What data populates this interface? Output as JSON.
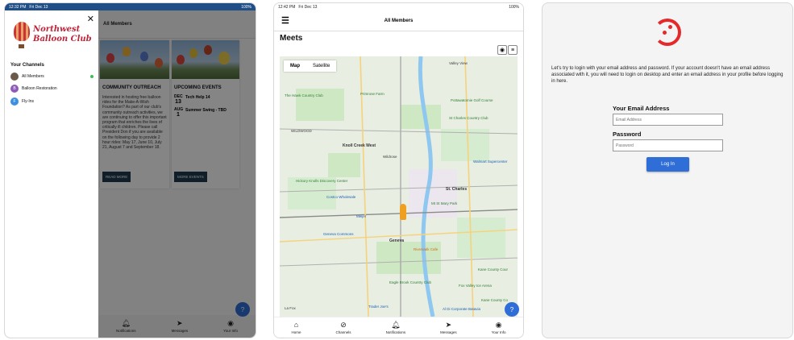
{
  "screen1": {
    "status": {
      "time": "12:32 PM",
      "date": "Fri Dec 13",
      "battery": "100%"
    },
    "header_title": "All Members",
    "logo_text": "Northwest Balloon Club",
    "channels_title": "Your Channels",
    "channels": [
      {
        "label": "All Members",
        "avatar": ""
      },
      {
        "label": "Balloon Restoration",
        "avatar": "B"
      },
      {
        "label": "Fly-Ins",
        "avatar": "F"
      }
    ],
    "card1": {
      "title": "COMMUNITY OUTREACH",
      "body": "Interested in hosting free balloon rides for the Make-A-Wish Foundation? As part of our club's community outreach activities, we are continuing to offer this important program that enriches the lives of critically ill children. Please call President Don if you are available on the following day to provide 2 hour rides: May 17, June 10, July 21, August 7 and September 18.",
      "button": "READ MORE"
    },
    "card2": {
      "title": "UPCOMING EVENTS",
      "events": [
        {
          "month": "DEC",
          "day": "13",
          "title": "Tech Help 14"
        },
        {
          "month": "AUG",
          "day": "1",
          "title": "Summer Swing - TBD"
        }
      ],
      "button": "MORE EVENTS"
    },
    "tabs": [
      {
        "label": "Notifications",
        "icon": "bell-icon"
      },
      {
        "label": "Messages",
        "icon": "send-icon"
      },
      {
        "label": "Your Info",
        "icon": "person-icon"
      }
    ]
  },
  "screen2": {
    "status": {
      "time": "12:42 PM",
      "date": "Fri Dec 13",
      "battery": "100%"
    },
    "header_title": "All Members",
    "section_title": "Meets",
    "map_tabs": {
      "map": "Map",
      "satellite": "Satellite"
    },
    "places": {
      "valley_view": "Valley View",
      "hawk_country_club": "The Hawk Country Club",
      "primrose_farm": "Primrose Farm",
      "pottawatomie": "Pottawatomie Golf Course",
      "st_charles_cc": "St Charles Country Club",
      "wildwood": "WILDWOOD",
      "knoll_creek_west": "Knoll Creek West",
      "wildrose": "Wildrose",
      "walmart": "Walmart Supercenter",
      "hickory_knolls": "Hickory Knolls Discovery Center",
      "costco": "Costco Wholesale",
      "st_charles": "St. Charles",
      "mt_st_mary": "Mt St Mary Park",
      "meijer": "Meijer",
      "geneva_commons": "Geneva Commons",
      "geneva": "Geneva",
      "riverwalk": "Riverwalk Cafe",
      "kane_county": "Kane County Cour",
      "eagle_brook": "Eagle Brook Country Club",
      "fox_valley": "Fox Valley Ice Arena",
      "trader_joes": "Trader Joe's",
      "al_di": "Al Di Corporate Batavia",
      "kane_county2": "Kane County Co",
      "la_fox": "La Fox"
    },
    "tabs": [
      {
        "label": "Home",
        "icon": "home-icon"
      },
      {
        "label": "Channels",
        "icon": "compass-icon"
      },
      {
        "label": "Notifications",
        "icon": "bell-icon"
      },
      {
        "label": "Messages",
        "icon": "send-icon"
      },
      {
        "label": "Your Info",
        "icon": "person-icon"
      }
    ]
  },
  "screen3": {
    "intro": "Let's try to login with your email address and password. If your account doesn't have an email address associated with it, you will need to login on desktop and enter an email address in your profile before logging in here.",
    "email_label": "Your Email Address",
    "email_placeholder": "Email Address",
    "password_label": "Password",
    "password_placeholder": "Password",
    "login_button": "Log In"
  },
  "colors": {
    "primary": "#2f6ed6",
    "brand_red": "#c0243b",
    "status_blue": "#1f4f86"
  }
}
